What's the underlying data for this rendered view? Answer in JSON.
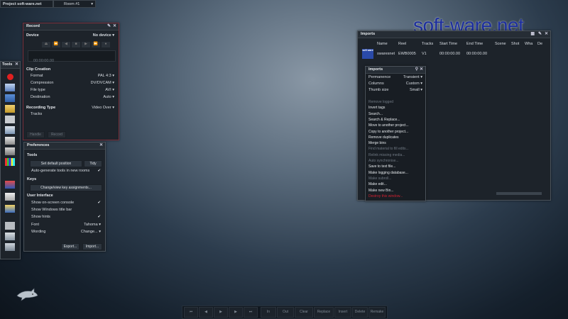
{
  "topbar": {
    "project_label": "Project soft-ware.net",
    "room_label": "Room #1"
  },
  "watermark": "soft-ware.net",
  "record": {
    "title": "Record",
    "device_label": "Device",
    "device_value": "No device",
    "timecode": "00:00:00.00",
    "clip_creation": "Clip Creation",
    "format_label": "Format",
    "format_value": "PAL 4:3",
    "compression_label": "Compression",
    "compression_value": "DV/DVCAM",
    "filetype_label": "File type",
    "filetype_value": "AVI",
    "destination_label": "Destination",
    "destination_value": "Auto",
    "recording_type": "Recording Type",
    "recording_type_value": "Video Over",
    "tracks_label": "Tracks",
    "handle_label": "Handle",
    "record_label": "Record"
  },
  "tools": {
    "title": "Tools"
  },
  "preferences": {
    "title": "Preferences",
    "tools_section": "Tools",
    "set_default": "Set default position",
    "tidy": "Tidy",
    "autogen": "Auto-generate tools in new rooms",
    "keys_section": "Keys",
    "change_keys": "Change/view key assignments...",
    "ui_section": "User Interface",
    "show_console": "Show on-screen console",
    "show_title_bar": "Show Windows title bar",
    "show_hints": "Show hints",
    "font_label": "Font",
    "font_value": "Tahoma",
    "wording_label": "Wording",
    "wording_value": "Change...",
    "export": "Export...",
    "import": "Import..."
  },
  "imports_window": {
    "title": "Imports",
    "columns": [
      "Name",
      "Reel",
      "Tracks",
      "Start Time",
      "End Time",
      "Scene",
      "Shot",
      "Wha",
      "De"
    ],
    "row": {
      "name": "swaresnet",
      "reel": "EWB0005",
      "tracks": "V1",
      "start": "00:00:00.00",
      "end": "00:00:00.00",
      "thumb_text": "soft ware"
    }
  },
  "imports_menu": {
    "title": "Imports",
    "permanence_label": "Permanence",
    "permanence_value": "Transient",
    "columns_label": "Columns",
    "columns_value": "Custom",
    "thumb_label": "Thumb size",
    "thumb_value": "Small",
    "items": [
      {
        "label": "Remove logged",
        "state": "dis"
      },
      {
        "label": "Invert tags",
        "state": ""
      },
      {
        "label": "Search...",
        "state": ""
      },
      {
        "label": "Search & Replace...",
        "state": ""
      },
      {
        "label": "Move to another project...",
        "state": ""
      },
      {
        "label": "Copy to another project...",
        "state": ""
      },
      {
        "label": "Remove duplicates",
        "state": ""
      },
      {
        "label": "Merge bins",
        "state": ""
      },
      {
        "label": "Find material to fill edits...",
        "state": "dis"
      },
      {
        "label": "Relink missing media...",
        "state": "dis"
      },
      {
        "label": "Auto synchronise...",
        "state": "dis"
      },
      {
        "label": "Save to text file...",
        "state": ""
      },
      {
        "label": "Make logging database...",
        "state": ""
      },
      {
        "label": "Make subroll...",
        "state": "dis"
      },
      {
        "label": "Make edit...",
        "state": ""
      },
      {
        "label": "Make new Bin...",
        "state": ""
      },
      {
        "label": "Destroy this window...",
        "state": "red"
      }
    ]
  },
  "transport": {
    "buttons": [
      "⏮",
      "◀",
      "▶",
      "▶",
      "⏭"
    ],
    "actions": [
      "In",
      "Out",
      "Clear",
      "Replace",
      "Insert",
      "Delete",
      "Remake"
    ]
  }
}
